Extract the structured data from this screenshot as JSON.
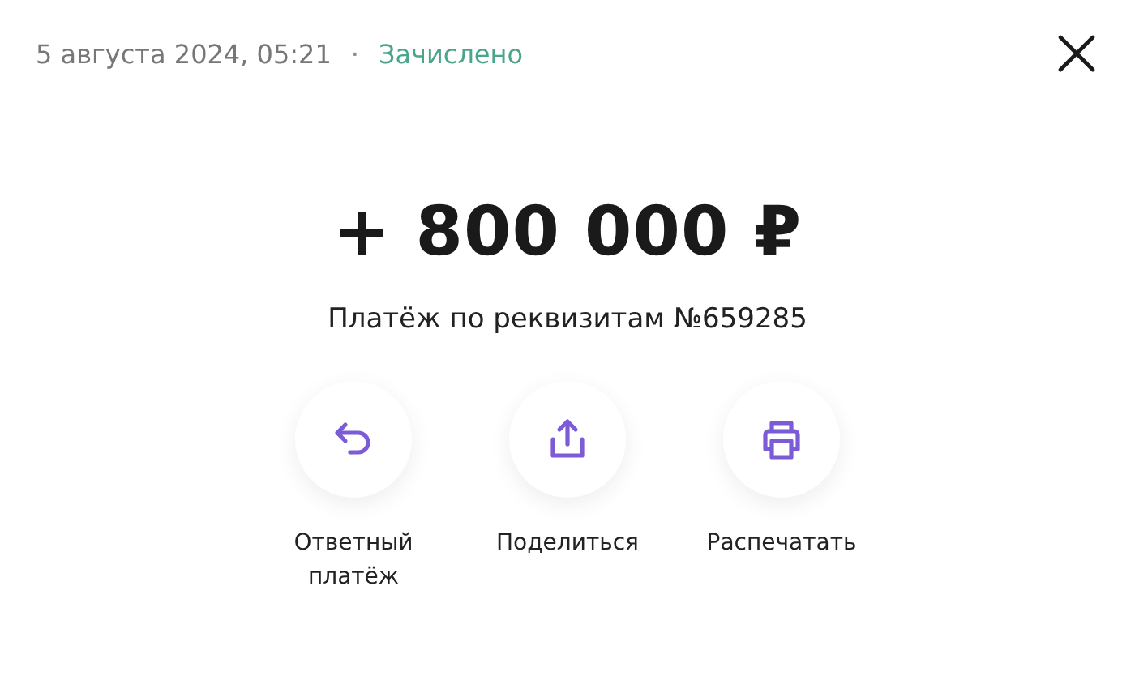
{
  "header": {
    "date": "5 августа 2024, 05:21",
    "separator": "·",
    "status": "Зачислено"
  },
  "amount": "+ 800 000 ₽",
  "description": "Платёж по реквизитам №659285",
  "actions": [
    {
      "kind": "reply",
      "label": "Ответный платёж"
    },
    {
      "kind": "share",
      "label": "Поделиться"
    },
    {
      "kind": "print",
      "label": "Распечатать"
    }
  ]
}
